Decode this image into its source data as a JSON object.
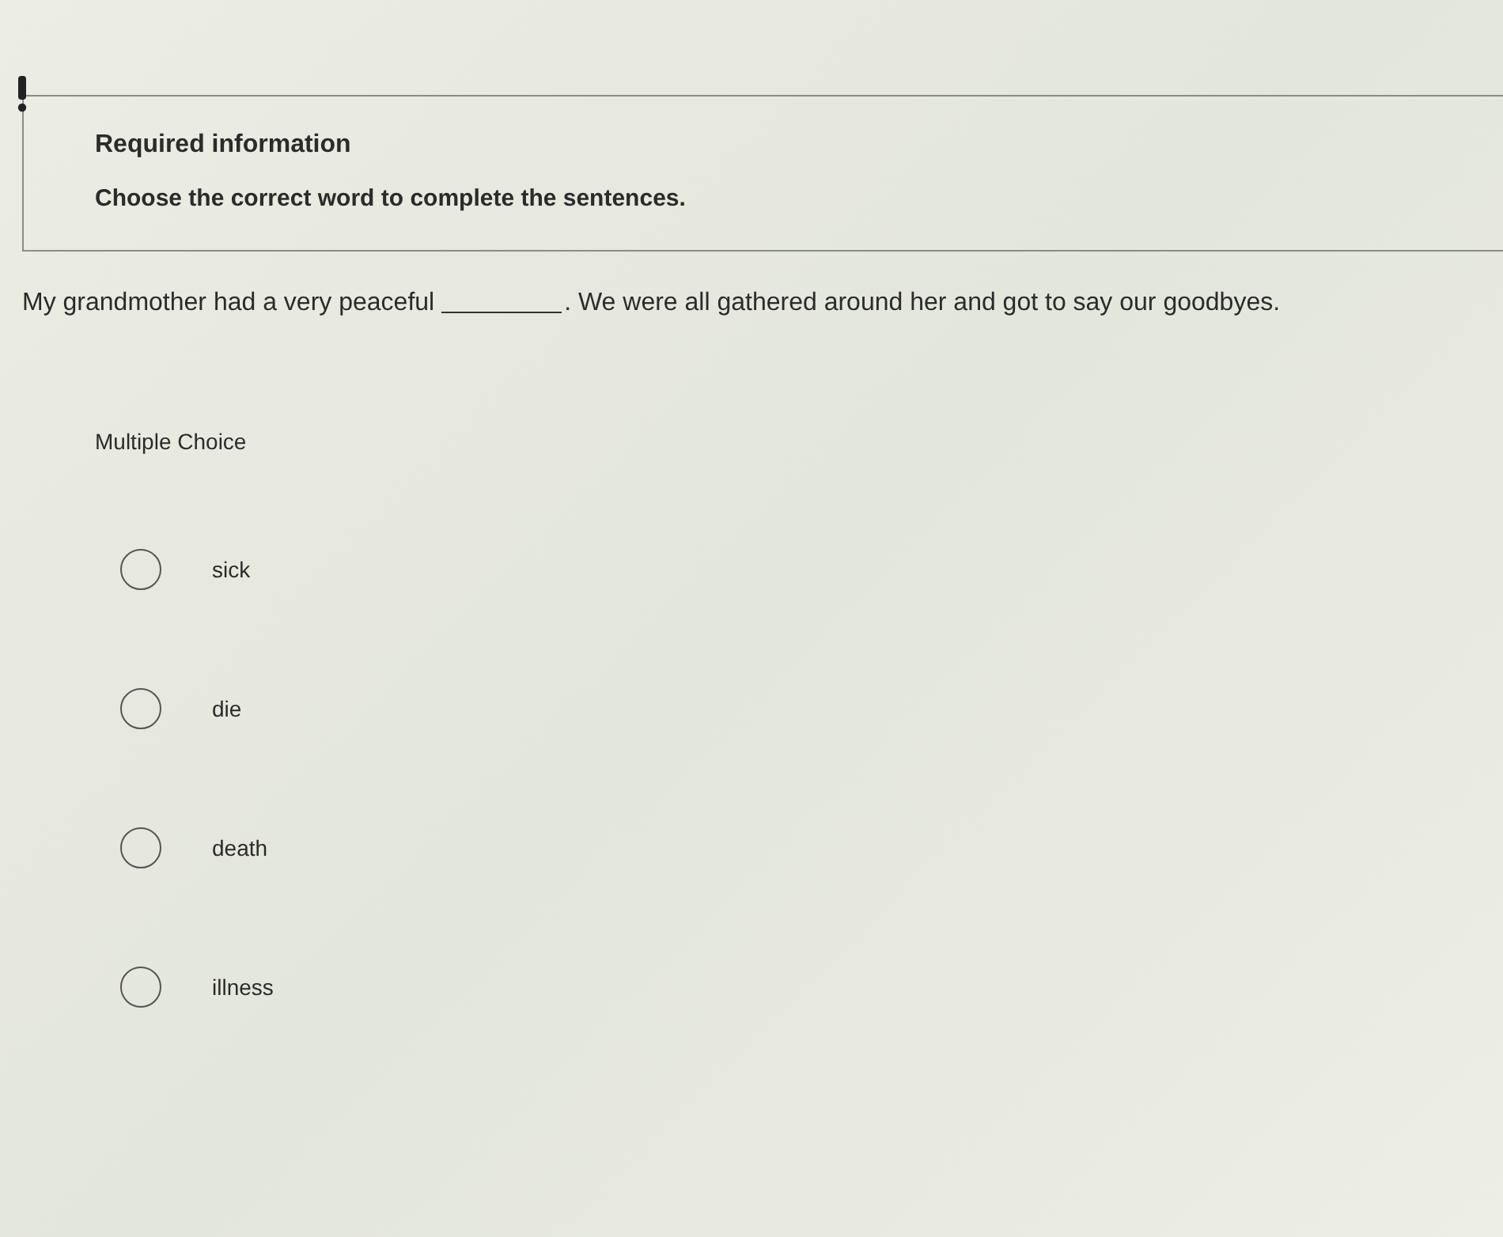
{
  "info_box": {
    "title": "Required information",
    "instruction": "Choose the correct word to complete the sentences."
  },
  "question": {
    "before_blank": "My grandmother had a very peaceful",
    "after_blank": ". We were all gathered around her and got to say our goodbyes."
  },
  "answer_type": "Multiple Choice",
  "options": [
    {
      "label": "sick",
      "selected": false
    },
    {
      "label": "die",
      "selected": false
    },
    {
      "label": "death",
      "selected": false
    },
    {
      "label": "illness",
      "selected": false
    }
  ]
}
